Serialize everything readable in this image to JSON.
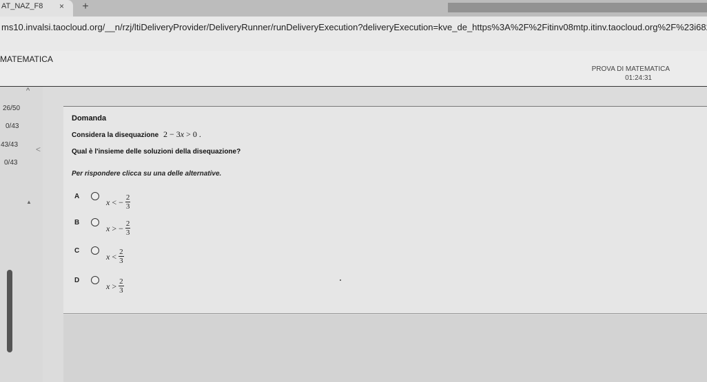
{
  "browser": {
    "tab_title": "AT_NAZ_F8",
    "tab_close": "×",
    "new_tab": "+",
    "url": "ms10.invalsi.taocloud.org/__n/rzj/ltiDeliveryProvider/DeliveryRunner/runDeliveryExecution?deliveryExecution=kve_de_https%3A%2F%2Fitinv08mtp.itinv.taocloud.org%2F%23i682d72d48401920..."
  },
  "header": {
    "subject": "MATEMATICA",
    "test_name": "PROVA DI MATEMATICA",
    "timer": "01:24:31"
  },
  "sidebar": {
    "up_icon": "^",
    "counts": [
      "26/50",
      "0/43",
      "43/43",
      "0/43"
    ],
    "collapse_icon": "<",
    "triangle_icon": "▲"
  },
  "question": {
    "heading": "Domanda",
    "line1": "Considera la disequazione",
    "inequality": {
      "lhs": "2 − 3",
      "var": "x",
      "rhs": " > 0 ."
    },
    "line2": "Qual è l'insieme delle soluzioni della disequazione?",
    "instruction": "Per rispondere clicca su una delle alternative."
  },
  "options": [
    {
      "letter": "A",
      "var": "x",
      "relation": "< −",
      "num": "2",
      "den": "3"
    },
    {
      "letter": "B",
      "var": "x",
      "relation": "> −",
      "num": "2",
      "den": "3"
    },
    {
      "letter": "C",
      "var": "x",
      "relation": "<",
      "num": "2",
      "den": "3"
    },
    {
      "letter": "D",
      "var": "x",
      "relation": ">",
      "num": "2",
      "den": "3"
    }
  ]
}
